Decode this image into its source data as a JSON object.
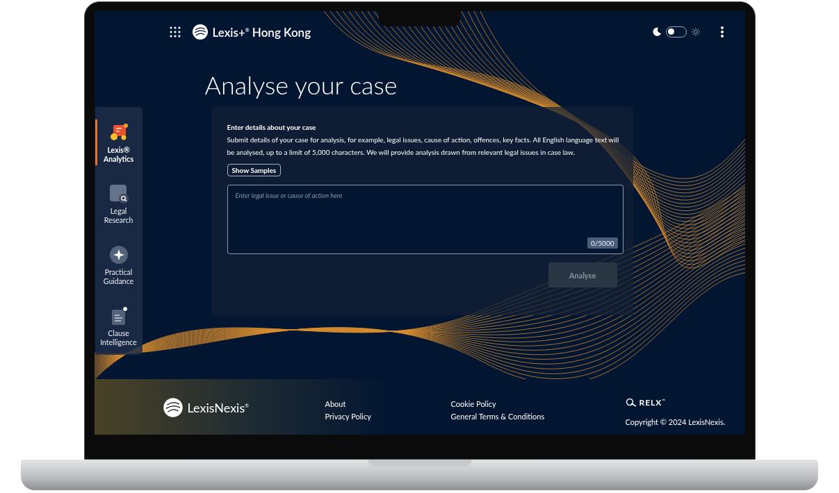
{
  "header": {
    "logo": "Lexis+$^{®}$ Hong Kong",
    "theme_toggle": {
      "on": false
    }
  },
  "sidebar": {
    "items": [
      {
        "label": "Lexis® Analytics",
        "kind": "analytics",
        "selected": true
      },
      {
        "label": "Legal Research",
        "kind": "research",
        "selected": false
      },
      {
        "label": "Practical Guidance",
        "kind": "guidance",
        "selected": false
      },
      {
        "label": "Clause Intelligence",
        "kind": "clause",
        "selected": false
      }
    ]
  },
  "page": {
    "title": "Analyse your case",
    "heading": "Enter details about your case",
    "description": "Submit details of your case for analysis, for example, legal issues, cause of action, offences, key facts. All English language text will be analysed, up to a limit of 5,000 characters. We will provide analysis drawn from relevant legal issues in case law.",
    "samples_button": "Show Samples",
    "case_field": {
      "placeholder": "Enter legal issue or cause of action here",
      "counter": "0/5000"
    },
    "analyse_button": {
      "label": "Analyse",
      "disabled": true
    }
  },
  "footer": {
    "logo": "LexisNexis$^{®}$",
    "links_1": [
      "About",
      "Privacy Policy"
    ],
    "links_2": [
      "Cookie Policy",
      "General Terms & Conditions"
    ],
    "relx_logo": "RELX$^{™}$",
    "copyright": "Copyright © 2024 LexisNexis."
  }
}
